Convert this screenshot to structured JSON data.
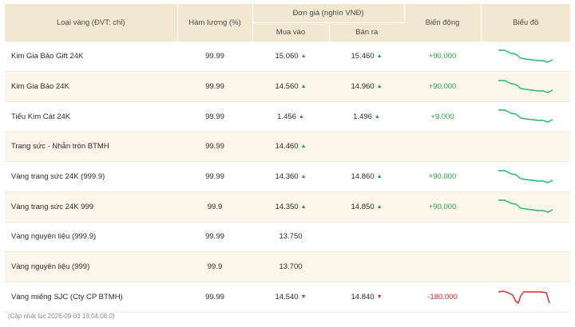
{
  "headers": {
    "type": "Loại vàng (ĐVT: chỉ)",
    "purity": "Hàm lượng (%)",
    "price_group": "Đơn giá (nghìn VNĐ)",
    "buy": "Mua vào",
    "sell": "Bán ra",
    "change": "Biến động",
    "chart": "Biểu đồ"
  },
  "colors": {
    "header_bg": "#f2e7d0",
    "up": "#1f9d3a",
    "down": "#d9262c",
    "spark_up": "#22b86a",
    "spark_down": "#e0262c"
  },
  "rows": [
    {
      "name": "Kim Gia Bảo Gift 24K",
      "purity": "99.99",
      "buy": "15.060",
      "buy_dir": "up",
      "sell": "15.460",
      "sell_dir": "up",
      "change": "+90.000",
      "change_dir": "up",
      "spark": "up"
    },
    {
      "name": "Kim Gia Bảo 24K",
      "purity": "99.99",
      "buy": "14.560",
      "buy_dir": "up",
      "sell": "14.960",
      "sell_dir": "up",
      "change": "+90.000",
      "change_dir": "up",
      "spark": "up"
    },
    {
      "name": "Tiểu Kim Cát 24K",
      "purity": "99.99",
      "buy": "1.456",
      "buy_dir": "up",
      "sell": "1.496",
      "sell_dir": "up",
      "change": "+9.000",
      "change_dir": "up",
      "spark": "up"
    },
    {
      "name": "Trang sức - Nhẫn tròn BTMH",
      "purity": "99.99",
      "buy": "14.460",
      "buy_dir": "up",
      "sell": "",
      "sell_dir": "",
      "change": "",
      "change_dir": "",
      "spark": ""
    },
    {
      "name": "Vàng trang sức 24K (999.9)",
      "purity": "99.99",
      "buy": "14.360",
      "buy_dir": "up",
      "sell": "14.860",
      "sell_dir": "up",
      "change": "+90.000",
      "change_dir": "up",
      "spark": "up"
    },
    {
      "name": "Vàng trang sức 24K 999",
      "purity": "99.9",
      "buy": "14.350",
      "buy_dir": "up",
      "sell": "14.850",
      "sell_dir": "up",
      "change": "+90.000",
      "change_dir": "up",
      "spark": "up"
    },
    {
      "name": "Vàng nguyên liệu (999.9)",
      "purity": "99.99",
      "buy": "13.750",
      "buy_dir": "",
      "sell": "",
      "sell_dir": "",
      "change": "",
      "change_dir": "",
      "spark": ""
    },
    {
      "name": "Vàng nguyên liệu (999)",
      "purity": "99.9",
      "buy": "13.700",
      "buy_dir": "",
      "sell": "",
      "sell_dir": "",
      "change": "",
      "change_dir": "",
      "spark": ""
    },
    {
      "name": "Vàng miếng SJC (Cty CP BTMH)",
      "purity": "99.99",
      "buy": "14.540",
      "buy_dir": "down",
      "sell": "14.840",
      "sell_dir": "down",
      "change": "-180.000",
      "change_dir": "down",
      "spark": "down"
    }
  ],
  "footer": "(Cập nhật lúc 2026-09-03 19:04:08.0)"
}
